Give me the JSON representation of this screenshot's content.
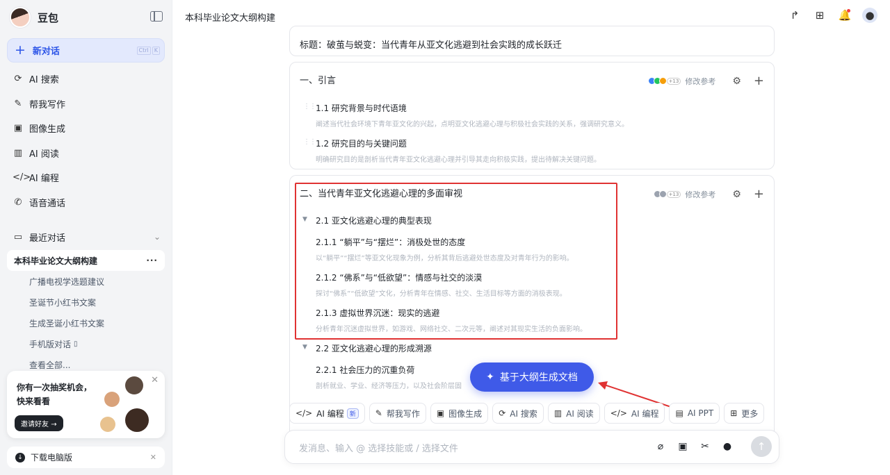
{
  "app": {
    "name": "豆包"
  },
  "sidebar": {
    "new_chat": "新对话",
    "shortcut": [
      "Ctrl",
      "K"
    ],
    "nav": [
      {
        "icon": "ai-search-icon",
        "label": "AI 搜索"
      },
      {
        "icon": "pen-icon",
        "label": "帮我写作"
      },
      {
        "icon": "image-icon",
        "label": "图像生成"
      },
      {
        "icon": "book-icon",
        "label": "AI 阅读"
      },
      {
        "icon": "code-icon",
        "label": "AI 编程"
      },
      {
        "icon": "phone-icon",
        "label": "语音通话"
      }
    ],
    "recent_label": "最近对话",
    "recent": [
      {
        "label": "本科毕业论文大纲构建",
        "active": true
      },
      {
        "label": "广播电视学选题建议"
      },
      {
        "label": "圣诞节小红书文案"
      },
      {
        "label": "生成圣诞小红书文案"
      },
      {
        "label": "手机版对话"
      },
      {
        "label": "查看全部..."
      }
    ],
    "promo": {
      "text": "你有一次抽奖机会，快来看看",
      "button": "邀请好友"
    },
    "download": "下载电脑版"
  },
  "header": {
    "title": "本科毕业论文大纲构建"
  },
  "outline": {
    "title_line": "标题：破茧与蜕变：当代青年从亚文化逃避到社会实践的成长跃迁",
    "section1": {
      "title": "一、引言",
      "ref_count": "+13",
      "modify": "修改参考",
      "items": [
        {
          "title": "1.1 研究背景与时代语境",
          "desc": "阐述当代社会环境下青年亚文化的兴起，点明亚文化逃避心理与积极社会实践的关系，强调研究意义。"
        },
        {
          "title": "1.2 研究目的与关键问题",
          "desc": "明确研究目的是剖析当代青年亚文化逃避心理并引导其走向积极实践，提出待解决关键问题。"
        }
      ]
    },
    "section2": {
      "title": "二、当代青年亚文化逃避心理的多面审视",
      "ref_count": "+13",
      "modify": "修改参考",
      "sub1": {
        "title": "2.1 亚文化逃避心理的典型表现",
        "items": [
          {
            "title": "2.1.1 “躺平”与“摆烂”：消极处世的态度",
            "desc": "以“躺平”“摆烂”等亚文化现象为例，分析其背后逃避处世态度及对青年行为的影响。"
          },
          {
            "title": "2.1.2 “佛系”与“低欲望”：情感与社交的淡漠",
            "desc": "探讨“佛系”“低欲望”文化，分析青年在情感、社交、生活目标等方面的消极表现。"
          },
          {
            "title": "2.1.3 虚拟世界沉迷：现实的逃避",
            "desc": "分析青年沉迷虚拟世界，如游戏、网络社交、二次元等，阐述对其现实生活的负面影响。"
          }
        ]
      },
      "sub2": {
        "title": "2.2 亚文化逃避心理的形成溯源",
        "items": [
          {
            "title": "2.2.1 社会压力的沉重负荷",
            "desc": "剖析就业、学业、经济等压力，以及社会阶层固"
          }
        ]
      }
    },
    "generate_button": "基于大纲生成文档"
  },
  "skills": [
    {
      "icon": "code-icon",
      "label": "AI 编程",
      "badge": "新"
    },
    {
      "icon": "pen-icon",
      "label": "帮我写作"
    },
    {
      "icon": "image-icon",
      "label": "图像生成"
    },
    {
      "icon": "ai-search-icon",
      "label": "AI 搜索"
    },
    {
      "icon": "book-icon",
      "label": "AI 阅读"
    },
    {
      "icon": "code-icon",
      "label": "AI 编程"
    },
    {
      "icon": "ppt-icon",
      "label": "AI PPT"
    },
    {
      "icon": "grid-icon",
      "label": "更多"
    }
  ],
  "input": {
    "placeholder": "发消息、输入 @ 选择技能或 / 选择文件"
  },
  "colors": {
    "accent": "#3f5ae8",
    "highlight": "#e03232",
    "sidebar_bg": "#f3f4f6"
  }
}
